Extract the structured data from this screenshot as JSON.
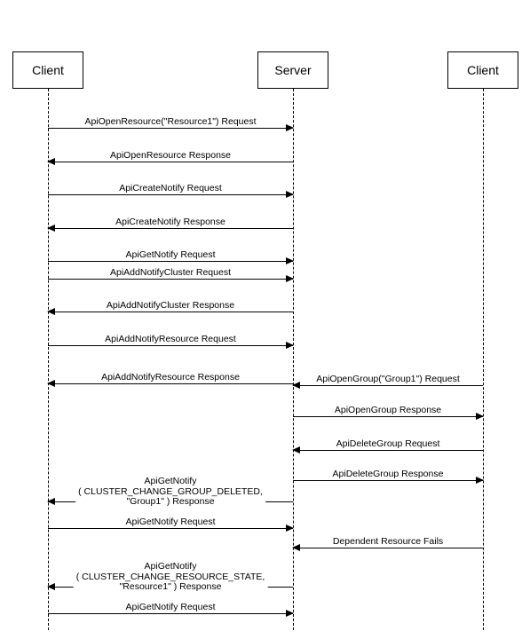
{
  "participants": {
    "client_left": "Client",
    "server": "Server",
    "client_right": "Client"
  },
  "messages": {
    "m1": "ApiOpenResource(\"Resource1\") Request",
    "m2": "ApiOpenResource Response",
    "m3": "ApiCreateNotify Request",
    "m4": "ApiCreateNotify Response",
    "m5": "ApiGetNotify Request",
    "m6": "ApiAddNotifyCluster Request",
    "m7": "ApiAddNotifyCluster Response",
    "m8": "ApiAddNotifyResource Request",
    "m9": "ApiAddNotifyResource Response",
    "m10": "ApiOpenGroup(\"Group1\") Request",
    "m11": "ApiOpenGroup Response",
    "m12": "ApiDeleteGroup Request",
    "m13": "ApiDeleteGroup Response",
    "m14_l1": "ApiGetNotify",
    "m14_l2": "( CLUSTER_CHANGE_GROUP_DELETED,",
    "m14_l3": "\"Group1\" ) Response",
    "m15": "ApiGetNotify Request",
    "m16": "Dependent Resource Fails",
    "m17_l1": "ApiGetNotify",
    "m17_l2": "( CLUSTER_CHANGE_RESOURCE_STATE,",
    "m17_l3": "\"Resource1\" ) Response",
    "m18": "ApiGetNotify Request"
  }
}
